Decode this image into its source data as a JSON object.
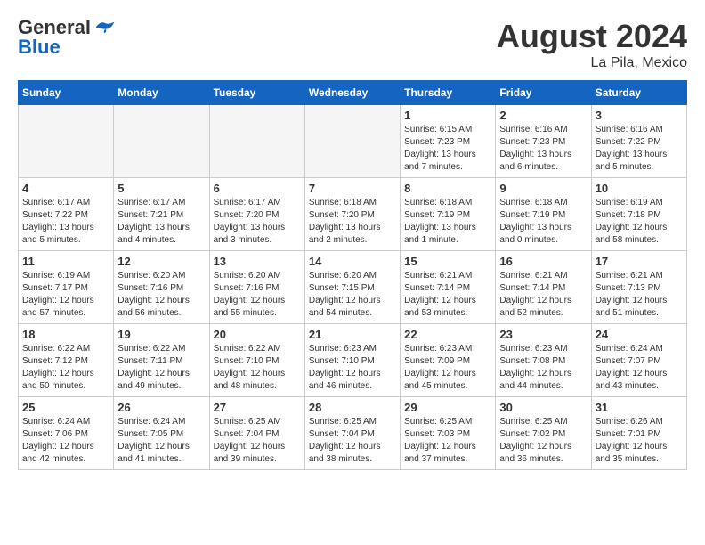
{
  "header": {
    "logo_general": "General",
    "logo_blue": "Blue",
    "month_year": "August 2024",
    "location": "La Pila, Mexico"
  },
  "days_of_week": [
    "Sunday",
    "Monday",
    "Tuesday",
    "Wednesday",
    "Thursday",
    "Friday",
    "Saturday"
  ],
  "weeks": [
    [
      {
        "day": "",
        "info": ""
      },
      {
        "day": "",
        "info": ""
      },
      {
        "day": "",
        "info": ""
      },
      {
        "day": "",
        "info": ""
      },
      {
        "day": "1",
        "info": "Sunrise: 6:15 AM\nSunset: 7:23 PM\nDaylight: 13 hours and 7 minutes."
      },
      {
        "day": "2",
        "info": "Sunrise: 6:16 AM\nSunset: 7:23 PM\nDaylight: 13 hours and 6 minutes."
      },
      {
        "day": "3",
        "info": "Sunrise: 6:16 AM\nSunset: 7:22 PM\nDaylight: 13 hours and 5 minutes."
      }
    ],
    [
      {
        "day": "4",
        "info": "Sunrise: 6:17 AM\nSunset: 7:22 PM\nDaylight: 13 hours and 5 minutes."
      },
      {
        "day": "5",
        "info": "Sunrise: 6:17 AM\nSunset: 7:21 PM\nDaylight: 13 hours and 4 minutes."
      },
      {
        "day": "6",
        "info": "Sunrise: 6:17 AM\nSunset: 7:20 PM\nDaylight: 13 hours and 3 minutes."
      },
      {
        "day": "7",
        "info": "Sunrise: 6:18 AM\nSunset: 7:20 PM\nDaylight: 13 hours and 2 minutes."
      },
      {
        "day": "8",
        "info": "Sunrise: 6:18 AM\nSunset: 7:19 PM\nDaylight: 13 hours and 1 minute."
      },
      {
        "day": "9",
        "info": "Sunrise: 6:18 AM\nSunset: 7:19 PM\nDaylight: 13 hours and 0 minutes."
      },
      {
        "day": "10",
        "info": "Sunrise: 6:19 AM\nSunset: 7:18 PM\nDaylight: 12 hours and 58 minutes."
      }
    ],
    [
      {
        "day": "11",
        "info": "Sunrise: 6:19 AM\nSunset: 7:17 PM\nDaylight: 12 hours and 57 minutes."
      },
      {
        "day": "12",
        "info": "Sunrise: 6:20 AM\nSunset: 7:16 PM\nDaylight: 12 hours and 56 minutes."
      },
      {
        "day": "13",
        "info": "Sunrise: 6:20 AM\nSunset: 7:16 PM\nDaylight: 12 hours and 55 minutes."
      },
      {
        "day": "14",
        "info": "Sunrise: 6:20 AM\nSunset: 7:15 PM\nDaylight: 12 hours and 54 minutes."
      },
      {
        "day": "15",
        "info": "Sunrise: 6:21 AM\nSunset: 7:14 PM\nDaylight: 12 hours and 53 minutes."
      },
      {
        "day": "16",
        "info": "Sunrise: 6:21 AM\nSunset: 7:14 PM\nDaylight: 12 hours and 52 minutes."
      },
      {
        "day": "17",
        "info": "Sunrise: 6:21 AM\nSunset: 7:13 PM\nDaylight: 12 hours and 51 minutes."
      }
    ],
    [
      {
        "day": "18",
        "info": "Sunrise: 6:22 AM\nSunset: 7:12 PM\nDaylight: 12 hours and 50 minutes."
      },
      {
        "day": "19",
        "info": "Sunrise: 6:22 AM\nSunset: 7:11 PM\nDaylight: 12 hours and 49 minutes."
      },
      {
        "day": "20",
        "info": "Sunrise: 6:22 AM\nSunset: 7:10 PM\nDaylight: 12 hours and 48 minutes."
      },
      {
        "day": "21",
        "info": "Sunrise: 6:23 AM\nSunset: 7:10 PM\nDaylight: 12 hours and 46 minutes."
      },
      {
        "day": "22",
        "info": "Sunrise: 6:23 AM\nSunset: 7:09 PM\nDaylight: 12 hours and 45 minutes."
      },
      {
        "day": "23",
        "info": "Sunrise: 6:23 AM\nSunset: 7:08 PM\nDaylight: 12 hours and 44 minutes."
      },
      {
        "day": "24",
        "info": "Sunrise: 6:24 AM\nSunset: 7:07 PM\nDaylight: 12 hours and 43 minutes."
      }
    ],
    [
      {
        "day": "25",
        "info": "Sunrise: 6:24 AM\nSunset: 7:06 PM\nDaylight: 12 hours and 42 minutes."
      },
      {
        "day": "26",
        "info": "Sunrise: 6:24 AM\nSunset: 7:05 PM\nDaylight: 12 hours and 41 minutes."
      },
      {
        "day": "27",
        "info": "Sunrise: 6:25 AM\nSunset: 7:04 PM\nDaylight: 12 hours and 39 minutes."
      },
      {
        "day": "28",
        "info": "Sunrise: 6:25 AM\nSunset: 7:04 PM\nDaylight: 12 hours and 38 minutes."
      },
      {
        "day": "29",
        "info": "Sunrise: 6:25 AM\nSunset: 7:03 PM\nDaylight: 12 hours and 37 minutes."
      },
      {
        "day": "30",
        "info": "Sunrise: 6:25 AM\nSunset: 7:02 PM\nDaylight: 12 hours and 36 minutes."
      },
      {
        "day": "31",
        "info": "Sunrise: 6:26 AM\nSunset: 7:01 PM\nDaylight: 12 hours and 35 minutes."
      }
    ]
  ]
}
